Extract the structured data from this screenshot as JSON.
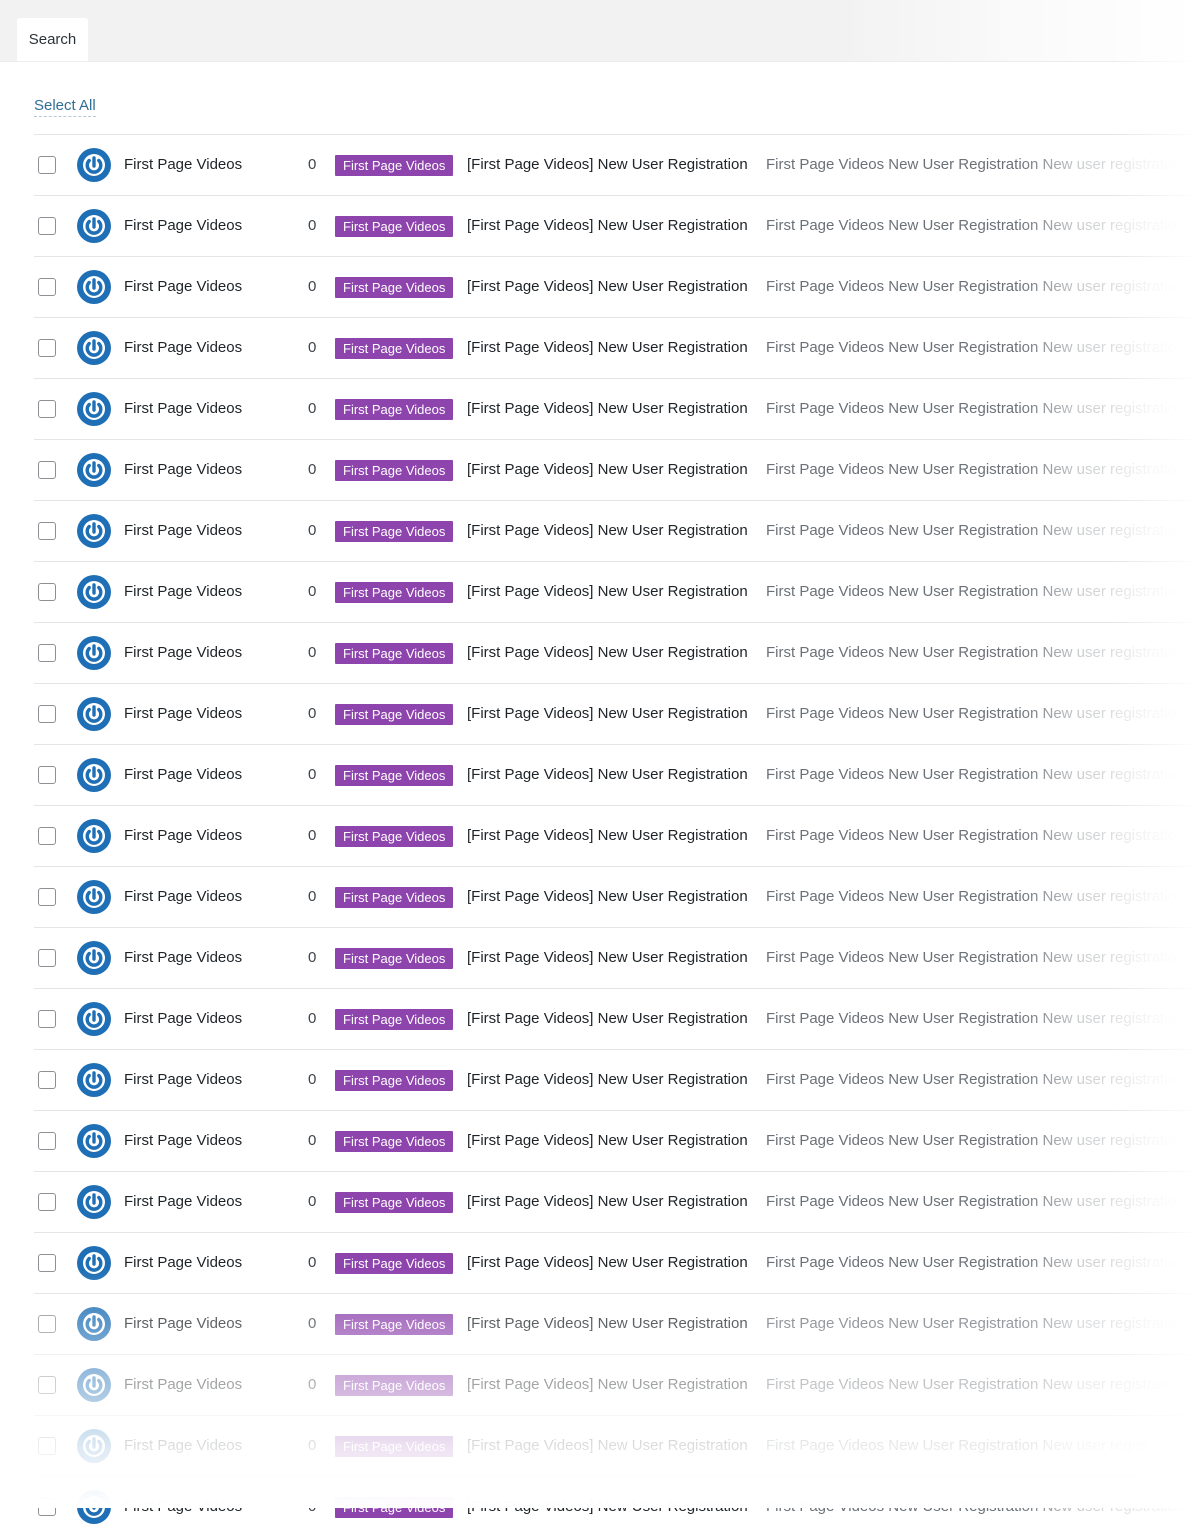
{
  "header": {
    "tab_label": "Search"
  },
  "list": {
    "select_all_label": "Select All",
    "colors": {
      "badge": "#8e44ad",
      "logo": "#1e6fb5",
      "link": "#2f6f94"
    },
    "rows": [
      {
        "name": "First Page Videos",
        "count": "0",
        "badge": "First Page Videos",
        "subject": "[First Page Videos] New User Registration",
        "preview": "First Page Videos New User Registration New user registration"
      },
      {
        "name": "First Page Videos",
        "count": "0",
        "badge": "First Page Videos",
        "subject": "[First Page Videos] New User Registration",
        "preview": "First Page Videos New User Registration New user registration"
      },
      {
        "name": "First Page Videos",
        "count": "0",
        "badge": "First Page Videos",
        "subject": "[First Page Videos] New User Registration",
        "preview": "First Page Videos New User Registration New user registration"
      },
      {
        "name": "First Page Videos",
        "count": "0",
        "badge": "First Page Videos",
        "subject": "[First Page Videos] New User Registration",
        "preview": "First Page Videos New User Registration New user registration"
      },
      {
        "name": "First Page Videos",
        "count": "0",
        "badge": "First Page Videos",
        "subject": "[First Page Videos] New User Registration",
        "preview": "First Page Videos New User Registration New user registration"
      },
      {
        "name": "First Page Videos",
        "count": "0",
        "badge": "First Page Videos",
        "subject": "[First Page Videos] New User Registration",
        "preview": "First Page Videos New User Registration New user registration"
      },
      {
        "name": "First Page Videos",
        "count": "0",
        "badge": "First Page Videos",
        "subject": "[First Page Videos] New User Registration",
        "preview": "First Page Videos New User Registration New user registration"
      },
      {
        "name": "First Page Videos",
        "count": "0",
        "badge": "First Page Videos",
        "subject": "[First Page Videos] New User Registration",
        "preview": "First Page Videos New User Registration New user registration"
      },
      {
        "name": "First Page Videos",
        "count": "0",
        "badge": "First Page Videos",
        "subject": "[First Page Videos] New User Registration",
        "preview": "First Page Videos New User Registration New user registration"
      },
      {
        "name": "First Page Videos",
        "count": "0",
        "badge": "First Page Videos",
        "subject": "[First Page Videos] New User Registration",
        "preview": "First Page Videos New User Registration New user registration"
      },
      {
        "name": "First Page Videos",
        "count": "0",
        "badge": "First Page Videos",
        "subject": "[First Page Videos] New User Registration",
        "preview": "First Page Videos New User Registration New user registration"
      },
      {
        "name": "First Page Videos",
        "count": "0",
        "badge": "First Page Videos",
        "subject": "[First Page Videos] New User Registration",
        "preview": "First Page Videos New User Registration New user registration"
      },
      {
        "name": "First Page Videos",
        "count": "0",
        "badge": "First Page Videos",
        "subject": "[First Page Videos] New User Registration",
        "preview": "First Page Videos New User Registration New user registration"
      },
      {
        "name": "First Page Videos",
        "count": "0",
        "badge": "First Page Videos",
        "subject": "[First Page Videos] New User Registration",
        "preview": "First Page Videos New User Registration New user registration"
      },
      {
        "name": "First Page Videos",
        "count": "0",
        "badge": "First Page Videos",
        "subject": "[First Page Videos] New User Registration",
        "preview": "First Page Videos New User Registration New user registration"
      },
      {
        "name": "First Page Videos",
        "count": "0",
        "badge": "First Page Videos",
        "subject": "[First Page Videos] New User Registration",
        "preview": "First Page Videos New User Registration New user registration"
      },
      {
        "name": "First Page Videos",
        "count": "0",
        "badge": "First Page Videos",
        "subject": "[First Page Videos] New User Registration",
        "preview": "First Page Videos New User Registration New user registration"
      },
      {
        "name": "First Page Videos",
        "count": "0",
        "badge": "First Page Videos",
        "subject": "[First Page Videos] New User Registration",
        "preview": "First Page Videos New User Registration New user registration"
      },
      {
        "name": "First Page Videos",
        "count": "0",
        "badge": "First Page Videos",
        "subject": "[First Page Videos] New User Registration",
        "preview": "First Page Videos New User Registration New user registration"
      },
      {
        "name": "First Page Videos",
        "count": "0",
        "badge": "First Page Videos",
        "subject": "[First Page Videos] New User Registration",
        "preview": "First Page Videos New User Registration New user registration"
      },
      {
        "name": "First Page Videos",
        "count": "0",
        "badge": "First Page Videos",
        "subject": "[First Page Videos] New User Registration",
        "preview": "First Page Videos New User Registration New user registration"
      },
      {
        "name": "First Page Videos",
        "count": "0",
        "badge": "First Page Videos",
        "subject": "[First Page Videos] New User Registration",
        "preview": "First Page Videos New User Registration New user registration"
      },
      {
        "name": "First Page Videos",
        "count": "0",
        "badge": "First Page Videos",
        "subject": "[First Page Videos] New User Registration",
        "preview": "First Page Videos New User Registration New user registration"
      }
    ]
  }
}
